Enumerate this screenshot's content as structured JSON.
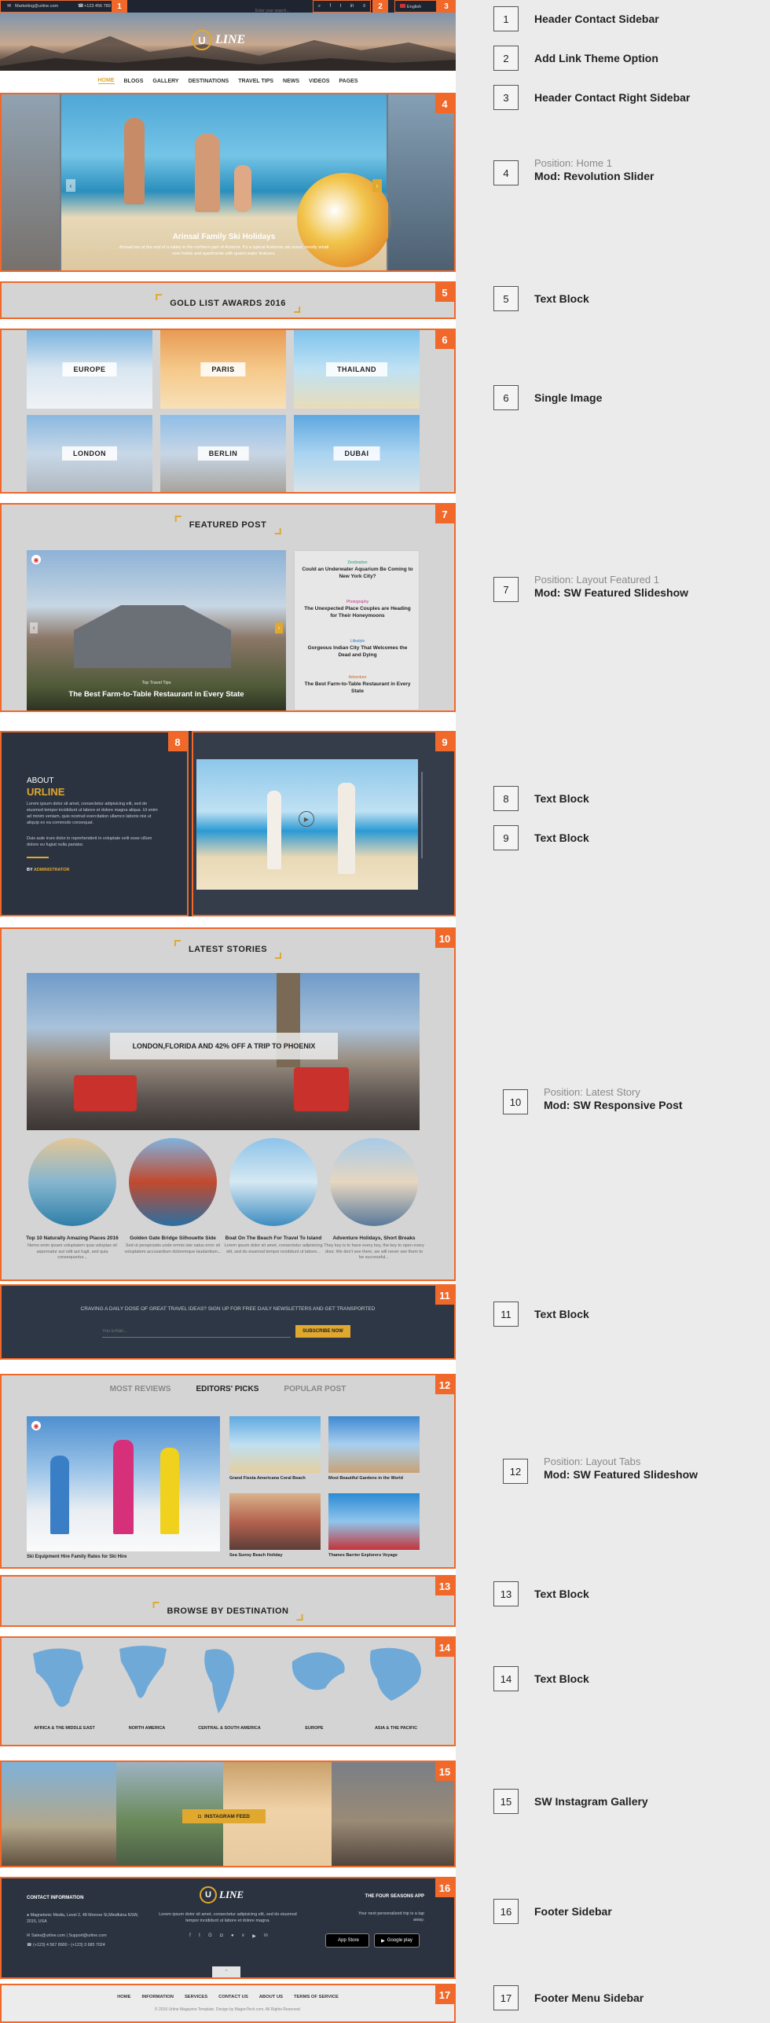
{
  "header": {
    "email": "Marketing@urline.com",
    "phone": "+123 456 789",
    "search_placeholder": "Enter your search...",
    "language": "English",
    "logo_text": "LINE",
    "nav": [
      "HOME",
      "BLOGS",
      "GALLERY",
      "DESTINATIONS",
      "TRAVEL TIPS",
      "NEWS",
      "VIDEOS",
      "PAGES"
    ]
  },
  "slider": {
    "title": "Arinsal Family Ski Holidays",
    "desc": "Arinsal lies at the end of a valley in the northern part of Andorra. It's a typical Andorran ski resort, mostly small new hotels and apartments with quaint water features."
  },
  "awards": {
    "title": "GOLD LIST AWARDS 2016"
  },
  "destinations": [
    "EUROPE",
    "PARIS",
    "THAILAND",
    "LONDON",
    "BERLIN",
    "DUBAI"
  ],
  "featured": {
    "title": "FEATURED POST",
    "main_title": "The Best Farm-to-Table Restaurant in Every State",
    "main_cat": "Top Travel Tips",
    "side": [
      {
        "cat": "Destination",
        "title": "Could an Underwater Aquarium Be Coming to New York City?"
      },
      {
        "cat": "Photography",
        "title": "The Unexpected Place Couples are Heading for Their Honeymoons"
      },
      {
        "cat": "Lifestyle",
        "title": "Gorgeous Indian City That Welcomes the Dead and Dying"
      },
      {
        "cat": "Adventure",
        "title": "The Best Farm-to-Table Restaurant in Every State"
      }
    ]
  },
  "about": {
    "label": "ABOUT",
    "brand": "URLINE",
    "text1": "Lorem ipsum dolor sit amet, consectetur adipisicing elit, sed do eiusmod tempor incididunt ut labore et dolore magna aliqua. Ut enim ad minim veniam, quis nostrud exercitation ullamco laboris nisi ut aliquip ex ea commodo consequat.",
    "text2": "Duis aute irure dolor in reprehenderit in voluptate velit esse cillum dolore eu fugiat nulla pariatur.",
    "by": "BY",
    "author": "ADMINISTRATOR"
  },
  "stories": {
    "title": "LATEST STORIES",
    "banner": "LONDON,FLORIDA AND 42% OFF A TRIP TO PHOENIX",
    "items": [
      {
        "title": "Top 10 Naturally Amazing Places 2016",
        "desc": "Nemo enim ipsam voluptatem quia voluptas sit aspernatur aut odit aut fugit, sed quia consequuntur..."
      },
      {
        "title": "Golden Gate Bridge Silhouette Side",
        "desc": "Sed ut perspiciatis unde omnis iste natus error sit voluptatem accusantium doloremque laudantium..."
      },
      {
        "title": "Boat On The Beach For Travel To Island",
        "desc": "Lorem ipsum dolor sit amet, consectetur adipisicing elit, sed do eiusmod tempor incididunt ut labore..."
      },
      {
        "title": "Adventure Holidays, Short Breaks",
        "desc": "They key is to have every key, the key to open every door. We don't see them, we will never see them to be successful..."
      }
    ]
  },
  "newsletter": {
    "text": "CRAVING A DAILY DOSE OF GREAT TRAVEL IDEAS? SIGN UP FOR FREE DAILY NEWSLETTERS AND GET TRANSPORTED",
    "placeholder": "You Email...",
    "button": "SUBSCRIBE NOW"
  },
  "tabs": {
    "labels": [
      "MOST REVIEWS",
      "EDITORS' PICKS",
      "POPULAR POST"
    ],
    "main_title": "Ski Equipment Hire Family Rates for Ski Hire",
    "items": [
      "Grand Fiesta Americana Coral Beach",
      "Most Beautiful Gardens in the World",
      "Sea Sunny Beach Holiday",
      "Thames Barrier Explorers Voyage"
    ]
  },
  "browse": {
    "title": "BROWSE BY DESTINATION",
    "regions": [
      "AFRICA & THE MIDDLE EAST",
      "NORTH AMERICA",
      "CENTRAL & SOUTH AMERICA",
      "EUROPE",
      "ASIA & THE PACIFIC"
    ]
  },
  "instagram": {
    "button": "INSTAGRAM FEED"
  },
  "footer": {
    "contact_title": "CONTACT INFORMATION",
    "address": "Magnetonic Media, Level 2, 48 Monroe St,Mindfulna NSW, 2015, USA",
    "emails": "Sales@urline.com | Support@urline.com",
    "phones": "(+123) 4 567 8900 - (+123) 3 685 7024",
    "logo_text": "LINE",
    "about": "Lorem ipsum dolor sit amet, consectetur adipisicing elit, sed do eiusmod tempor incididunt ut labore et dolore magna.",
    "app_title": "THE FOUR SEASONS APP",
    "app_desc": "Your next personalized trip is a tap away.",
    "appstore": "App Store",
    "googleplay": "Google play",
    "menu": [
      "HOME",
      "INFORMATION",
      "SERVICES",
      "CONTACT US",
      "ABOUT US",
      "TERMS OF SERVICE"
    ],
    "copyright": "© 2016 Urline Magazine Template. Design by MagenTech.com. All Rights Reserved."
  },
  "legend": [
    {
      "num": "1",
      "pos": "",
      "text": "Header Contact Sidebar"
    },
    {
      "num": "2",
      "pos": "",
      "text": "Add Link Theme Option"
    },
    {
      "num": "3",
      "pos": "",
      "text": "Header Contact Right Sidebar"
    },
    {
      "num": "4",
      "pos": "Position: Home 1",
      "text": "Mod: Revolution Slider"
    },
    {
      "num": "5",
      "pos": "",
      "text": "Text Block"
    },
    {
      "num": "6",
      "pos": "",
      "text": "Single Image"
    },
    {
      "num": "7",
      "pos": "Position: Layout Featured 1",
      "text": "Mod: SW Featured Slideshow"
    },
    {
      "num": "8",
      "pos": "",
      "text": "Text Block"
    },
    {
      "num": "9",
      "pos": "",
      "text": "Text Block"
    },
    {
      "num": "10",
      "pos": "Position: Latest Story",
      "text": "Mod: SW Responsive Post"
    },
    {
      "num": "11",
      "pos": "",
      "text": "Text Block"
    },
    {
      "num": "12",
      "pos": "Position: Layout Tabs",
      "text": "Mod: SW Featured Slideshow"
    },
    {
      "num": "13",
      "pos": "",
      "text": "Text Block"
    },
    {
      "num": "14",
      "pos": "",
      "text": "Text Block"
    },
    {
      "num": "15",
      "pos": "",
      "text": "SW Instagram Gallery"
    },
    {
      "num": "16",
      "pos": "",
      "text": "Footer Sidebar"
    },
    {
      "num": "17",
      "pos": "",
      "text": "Footer Menu Sidebar"
    }
  ]
}
